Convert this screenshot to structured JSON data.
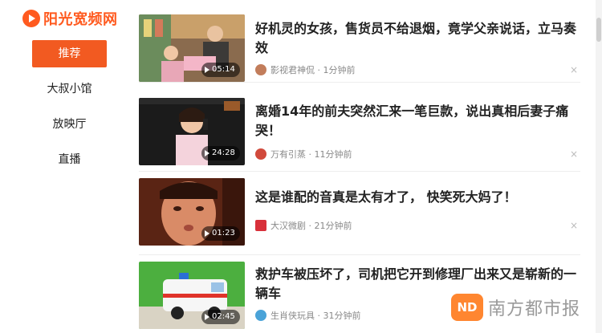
{
  "logo": {
    "text": "阳光宽频网"
  },
  "nav": [
    {
      "label": "推荐",
      "active": true
    },
    {
      "label": "大叔小馆",
      "active": false
    },
    {
      "label": "放映厅",
      "active": false
    },
    {
      "label": "直播",
      "active": false
    }
  ],
  "feed": [
    {
      "title": "好机灵的女孩，售货员不给退烟，竟学父亲说话，立马奏效",
      "duration": "05:14",
      "source": "影视君神侃",
      "time": "1分钟前",
      "close": "×"
    },
    {
      "title": "离婚14年的前夫突然汇来一笔巨款，说出真相后妻子痛哭！",
      "duration": "24:28",
      "source": "万有引蒸",
      "time": "11分钟前",
      "close": "×"
    },
    {
      "title": "这是谁配的音真是太有才了， 快笑死大妈了！",
      "duration": "01:23",
      "source": "大汉微剧",
      "time": "21分钟前",
      "close": "×"
    },
    {
      "title": "救护车被压坏了，司机把它开到修理厂出来又是崭新的一辆车",
      "duration": "02:45",
      "source": "生肖侠玩具",
      "time": "31分钟前",
      "close": "×"
    }
  ],
  "watermark": {
    "badge": "ND",
    "text": "南方都市报"
  }
}
